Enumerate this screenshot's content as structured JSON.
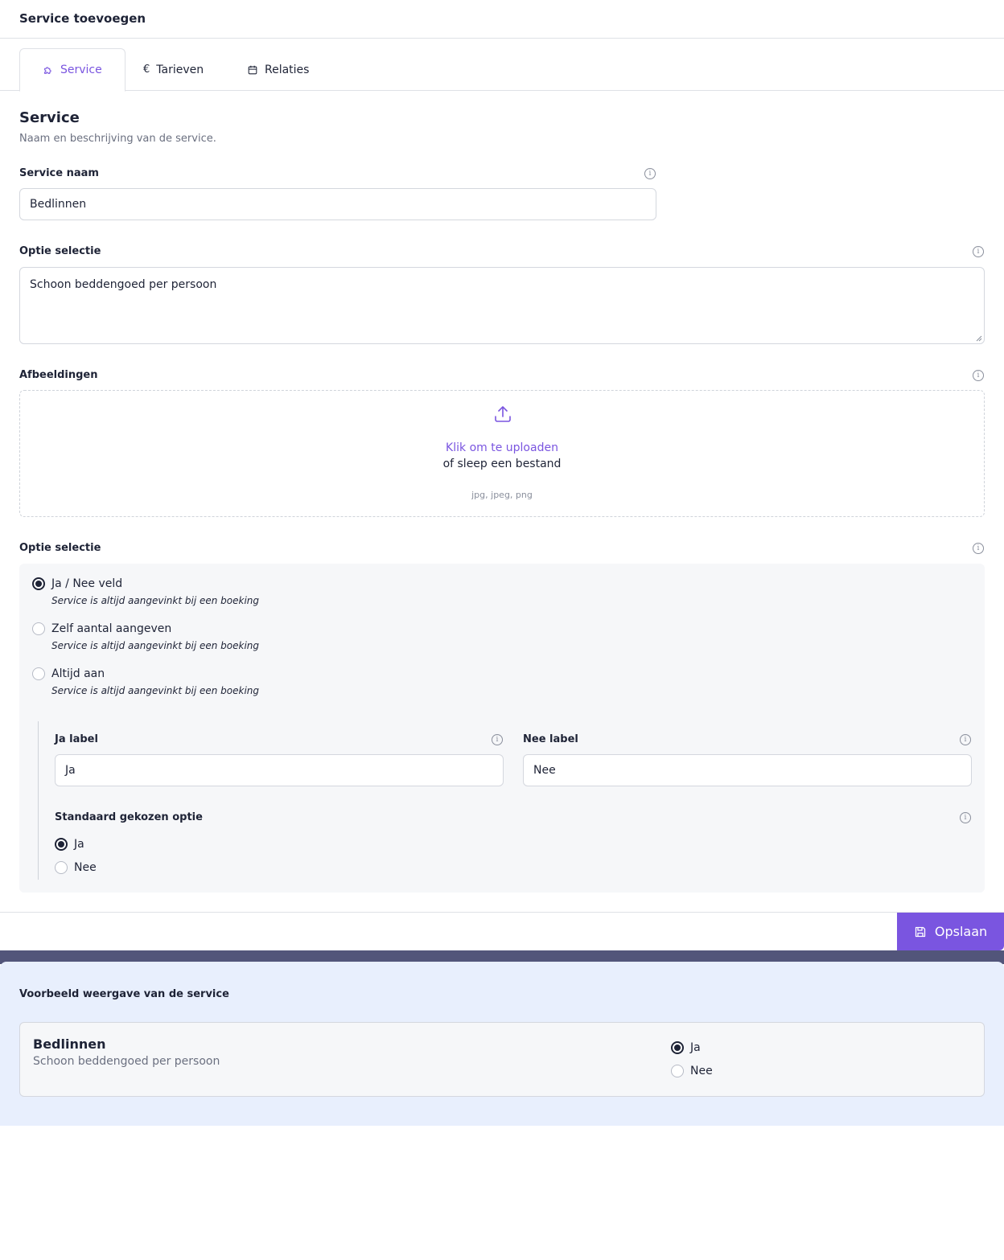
{
  "header": {
    "title": "Service toevoegen"
  },
  "tabs": [
    {
      "label": "Service",
      "icon": "puzzle-icon",
      "active": true
    },
    {
      "label": "Tarieven",
      "icon": "euro-icon",
      "active": false
    },
    {
      "label": "Relaties",
      "icon": "calendar-icon",
      "active": false
    }
  ],
  "section": {
    "title": "Service",
    "description": "Naam en beschrijving van de service."
  },
  "fields": {
    "service_name": {
      "label": "Service naam",
      "value": "Bedlinnen"
    },
    "description": {
      "label": "Optie selectie",
      "value": "Schoon beddengoed per persoon"
    },
    "images": {
      "label": "Afbeeldingen",
      "click_text": "Klik om te uploaden",
      "drag_text": "of sleep een bestand",
      "types": "jpg, jpeg, png"
    }
  },
  "option_selection": {
    "label": "Optie selectie",
    "options": [
      {
        "label": "Ja / Nee veld",
        "help": "Service is altijd aangevinkt bij een boeking",
        "selected": true
      },
      {
        "label": "Zelf aantal aangeven",
        "help": "Service is altijd aangevinkt bij een boeking",
        "selected": false
      },
      {
        "label": "Altijd aan",
        "help": "Service is altijd aangevinkt bij een boeking",
        "selected": false
      }
    ],
    "ja_label": {
      "label": "Ja label",
      "value": "Ja"
    },
    "nee_label": {
      "label": "Nee label",
      "value": "Nee"
    },
    "default_option": {
      "label": "Standaard gekozen optie",
      "options": [
        {
          "label": "Ja",
          "selected": true
        },
        {
          "label": "Nee",
          "selected": false
        }
      ]
    }
  },
  "footer": {
    "save_label": "Opslaan"
  },
  "preview": {
    "title": "Voorbeeld weergave van de service",
    "name": "Bedlinnen",
    "description": "Schoon beddengoed per persoon",
    "options": [
      {
        "label": "Ja",
        "selected": true
      },
      {
        "label": "Nee",
        "selected": false
      }
    ]
  },
  "colors": {
    "accent": "#7a55e0",
    "text": "#1e2336",
    "muted": "#6b7080",
    "options_bg": "#f6f7f9",
    "preview_bg": "#e8effd",
    "dark_band": "#52557a"
  }
}
